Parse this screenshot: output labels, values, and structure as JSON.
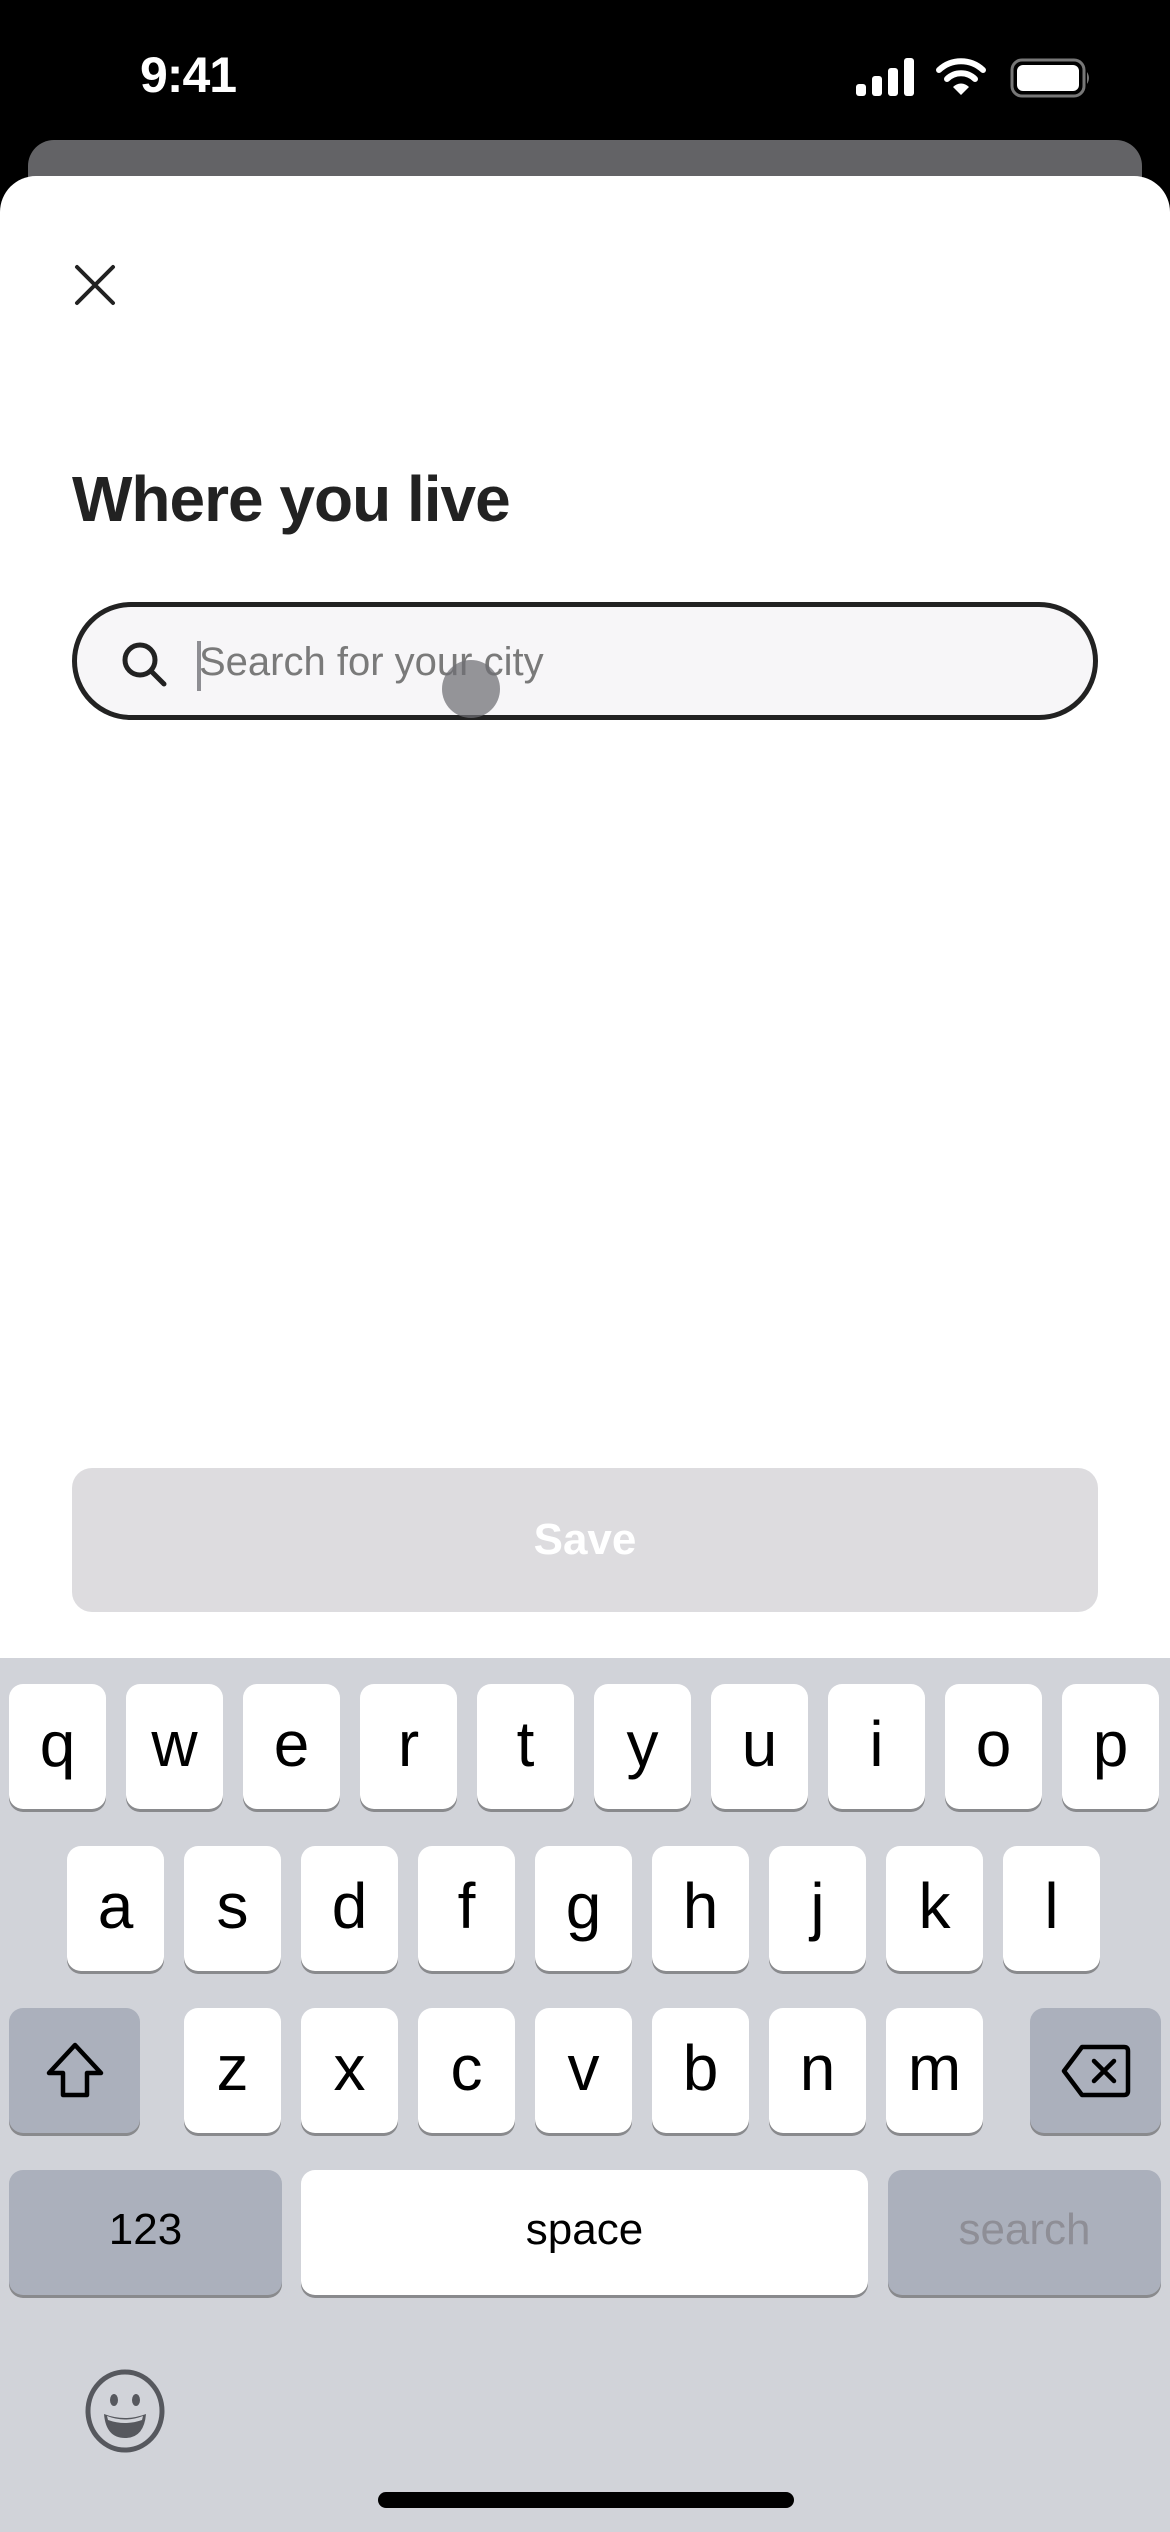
{
  "status_bar": {
    "time": "9:41",
    "icons": [
      "cellular-signal-icon",
      "wifi-icon",
      "battery-icon"
    ]
  },
  "sheet": {
    "close_icon": "close-icon",
    "title": "Where you live",
    "search": {
      "value": "",
      "placeholder": "Search for your city",
      "icon": "search-icon"
    },
    "save_label": "Save",
    "save_enabled": false
  },
  "keyboard": {
    "row1": [
      "q",
      "w",
      "e",
      "r",
      "t",
      "y",
      "u",
      "i",
      "o",
      "p"
    ],
    "row2": [
      "a",
      "s",
      "d",
      "f",
      "g",
      "h",
      "j",
      "k",
      "l"
    ],
    "row3": [
      "z",
      "x",
      "c",
      "v",
      "b",
      "n",
      "m"
    ],
    "shift_icon": "shift-icon",
    "delete_icon": "delete-icon",
    "numbers_label": "123",
    "space_label": "space",
    "return_label": "search",
    "emoji_icon": "emoji-icon"
  },
  "colors": {
    "accent": "#222222",
    "disabled_button": "#dddcdf",
    "keyboard_bg": "#d1d3d9",
    "function_key": "#abb0bc"
  }
}
